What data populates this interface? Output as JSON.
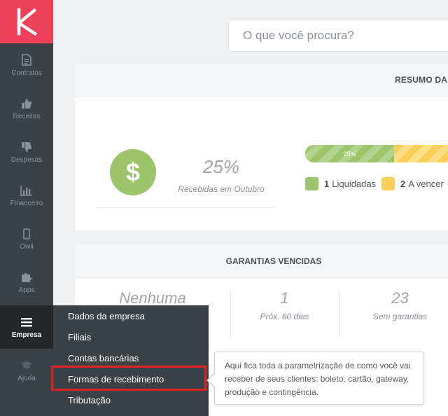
{
  "colors": {
    "brand": "#f0415a",
    "sidebar_bg": "#3c4145",
    "active_bg": "#24282b",
    "green": "#9cc46a",
    "yellow": "#f7cf59",
    "highlight": "#e01c24"
  },
  "sidebar": {
    "logo_icon": "k-logo-icon",
    "items": [
      {
        "label": "Contratos",
        "icon": "document-icon"
      },
      {
        "label": "Receitas",
        "icon": "thumbs-up-icon"
      },
      {
        "label": "Despesas",
        "icon": "thumbs-down-icon"
      },
      {
        "label": "Financeiro",
        "icon": "bar-chart-icon"
      },
      {
        "label": "Owli",
        "icon": "phone-icon"
      },
      {
        "label": "Apps",
        "icon": "puzzle-icon"
      },
      {
        "label": "Empresa",
        "icon": "menu-icon",
        "active": true
      },
      {
        "label": "Ajuda",
        "icon": "graduation-cap-icon"
      }
    ]
  },
  "search": {
    "placeholder": "O que você procura?"
  },
  "summary": {
    "title": "RESUMO DA",
    "dollar_symbol": "$",
    "percent": "25%",
    "percent_label": "Recebidas em Outubro",
    "bar_label": "25%",
    "liquidated_fraction": 0.25,
    "legend": [
      {
        "count": "1",
        "label": "Liquidadas"
      },
      {
        "count": "2",
        "label": "A vencer"
      }
    ]
  },
  "warranties": {
    "title": "GARANTIAS VENCIDAS",
    "stats": [
      {
        "value": "Nenhuma",
        "label": ""
      },
      {
        "value": "1",
        "label": "Próx. 60 dias"
      },
      {
        "value": "23",
        "label": "Sem garantias"
      }
    ]
  },
  "dropdown": {
    "items": [
      {
        "label": "Dados da empresa"
      },
      {
        "label": "Filiais"
      },
      {
        "label": "Contas bancárias"
      },
      {
        "label": "Formas de recebimento"
      },
      {
        "label": "Tributação"
      }
    ]
  },
  "tooltip": {
    "text": "Aqui fica toda a parametrização de como você vai receber de seus clientes: boleto, cartão, gateway, produção e contingência."
  }
}
